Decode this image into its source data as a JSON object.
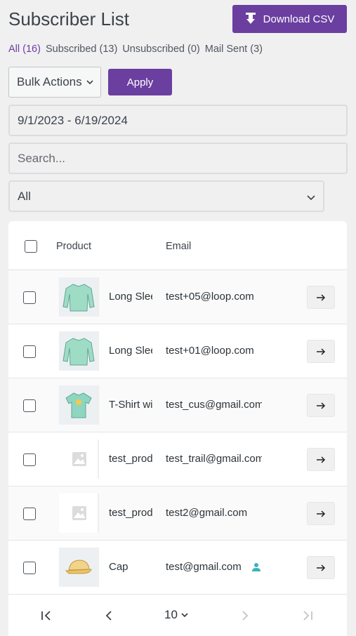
{
  "header": {
    "title": "Subscriber List",
    "download_label": "Download CSV"
  },
  "filters": [
    {
      "label": "All",
      "count": "(16)",
      "active": true
    },
    {
      "label": "Subscribed",
      "count": "(13)",
      "active": false
    },
    {
      "label": "Unsubscribed",
      "count": "(0)",
      "active": false
    },
    {
      "label": "Mail Sent",
      "count": "(3)",
      "active": false
    }
  ],
  "toolbar": {
    "bulk_actions_value": "Bulk Actions",
    "apply_label": "Apply",
    "date_range_value": "9/1/2023 - 6/19/2024",
    "search_placeholder": "Search...",
    "status_select_value": "All"
  },
  "table": {
    "columns": {
      "product": "Product",
      "email": "Email"
    },
    "rows": [
      {
        "product": "Long Sleeve Tee",
        "email": "test+05@loop.com",
        "thumb": "long-sleeve-shirt"
      },
      {
        "product": "Long Sleeve Tee",
        "email": "test+01@loop.com",
        "thumb": "long-sleeve-shirt"
      },
      {
        "product": "T-Shirt with Logo",
        "email": "test_cus@gmail.com",
        "thumb": "t-shirt"
      },
      {
        "product": "test_product",
        "email": "test_trail@gmail.com",
        "thumb": "image-placeholder"
      },
      {
        "product": "test_product",
        "email": "test2@gmail.com",
        "thumb": "image-placeholder"
      },
      {
        "product": "Cap",
        "email": "test@gmail.com",
        "thumb": "cap",
        "user_icon": true
      }
    ]
  },
  "pagination": {
    "page_size": "10"
  },
  "colors": {
    "accent": "#6b3fa0",
    "background": "#f0f0f1",
    "user_icon": "#3bb3b8"
  }
}
